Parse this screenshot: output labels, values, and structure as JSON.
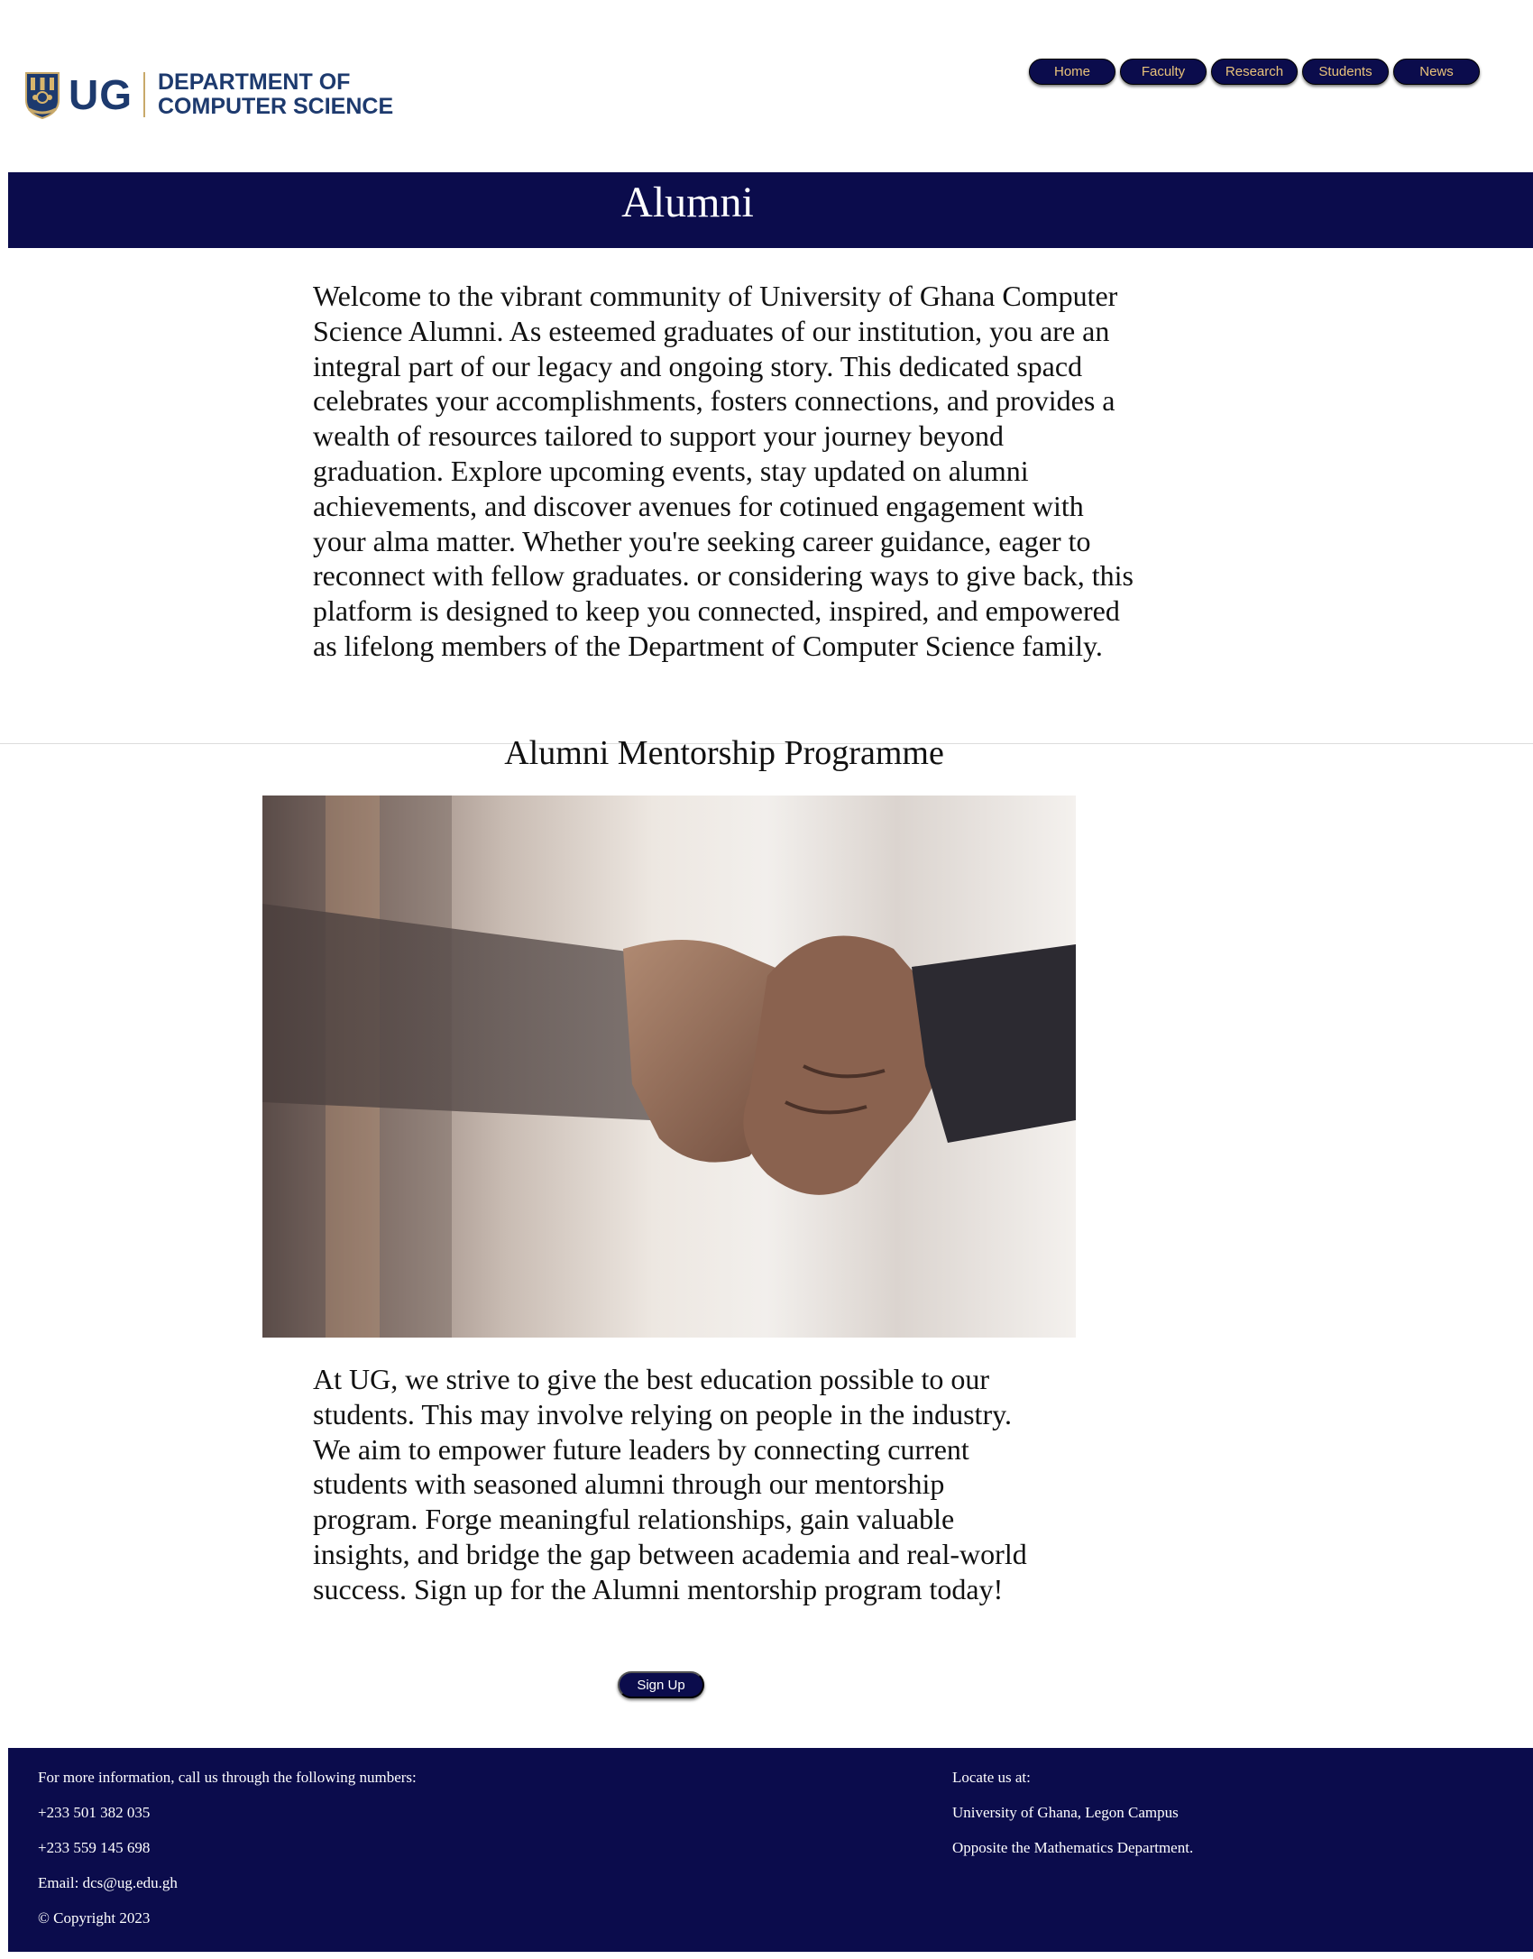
{
  "header": {
    "logo_mark": "UG",
    "dept_line1": "DEPARTMENT OF",
    "dept_line2": "COMPUTER SCIENCE",
    "nav": [
      "Home",
      "Faculty",
      "Research",
      "Students",
      "News"
    ]
  },
  "page": {
    "title": "Alumni"
  },
  "intro": {
    "text": "Welcome to the vibrant community of University of Ghana Computer Science Alumni. As esteemed graduates of our institution, you are an integral part of our legacy and ongoing story. This dedicated spacd celebrates your accomplishments, fosters connections, and provides a wealth of resources tailored to support your journey beyond graduation. Explore upcoming events, stay updated on alumni achievements, and discover avenues for cotinued engagement with your alma matter. Whether you're seeking career guidance, eager to reconnect with fellow graduates. or considering ways to give back, this platform is designed to keep you connected, inspired, and empowered as lifelong members of the Department of Computer Science family."
  },
  "mentorship": {
    "title": "Alumni Mentorship Programme",
    "image_icon": "handshake-photo",
    "text": "At UG, we strive to give the best education possible to our students. This may involve relying on people in the industry. We aim to empower future leaders by connecting current students with seasoned alumni through our mentorship program. Forge meaningful relationships, gain valuable insights, and bridge the gap between academia and real-world success. Sign up for the Alumni mentorship program today!",
    "signup_label": "Sign Up"
  },
  "footer": {
    "left": [
      "For more information, call us through the following numbers:",
      "+233 501 382 035",
      "+233 559 145 698",
      "Email: dcs@ug.edu.gh",
      "© Copyright 2023"
    ],
    "right": [
      "Locate us at:",
      "University of Ghana, Legon Campus",
      "Opposite the Mathematics Department."
    ]
  },
  "colors": {
    "navy": "#0b0c4c",
    "nav_text": "#e8c27a",
    "logo_blue": "#1d3a6e"
  }
}
